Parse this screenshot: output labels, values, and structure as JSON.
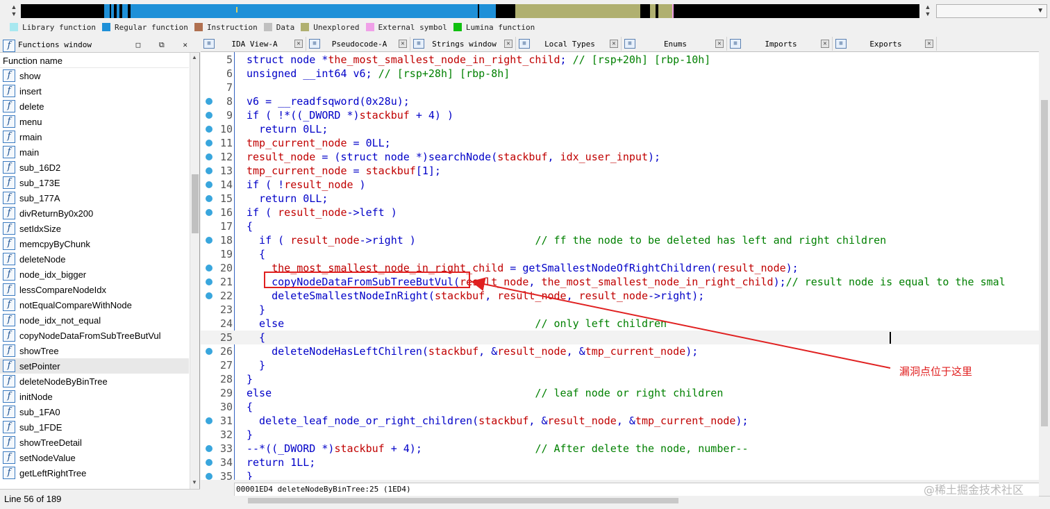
{
  "colors": {
    "library": "#a8e8f0",
    "regular": "#1e90d8",
    "instruction": "#b07050",
    "data": "#c0c0c0",
    "unexplored": "#b0b070",
    "external": "#f0a0e8",
    "lumina": "#10c010",
    "annotation": "#e02020"
  },
  "legend": [
    {
      "label": "Library function",
      "color": "#a8e8f0"
    },
    {
      "label": "Regular function",
      "color": "#1e90d8"
    },
    {
      "label": "Instruction",
      "color": "#b07050"
    },
    {
      "label": "Data",
      "color": "#c0c0c0"
    },
    {
      "label": "Unexplored",
      "color": "#b0b070"
    },
    {
      "label": "External symbol",
      "color": "#f0a0e8"
    },
    {
      "label": "Lumina function",
      "color": "#10c010"
    }
  ],
  "functions_window": {
    "title": "Functions window",
    "header": "Function name",
    "status": "Line 56 of 189",
    "items": [
      "show",
      "insert",
      "delete",
      "menu",
      "rmain",
      "main",
      "sub_16D2",
      "sub_173E",
      "sub_177A",
      "divReturnBy0x200",
      "setIdxSize",
      "memcpyByChunk",
      "deleteNode",
      "node_idx_bigger",
      "lessCompareNodeIdx",
      "notEqualCompareWithNode",
      "node_idx_not_equal",
      "copyNodeDataFromSubTreeButVul",
      "showTree",
      "setPointer",
      "deleteNodeByBinTree",
      "initNode",
      "sub_1FA0",
      "sub_1FDE",
      "showTreeDetail",
      "setNodeValue",
      "getLeftRightTree"
    ],
    "selected": "setPointer"
  },
  "tabs": [
    {
      "label": "IDA View-A",
      "icon": "ida-view-icon"
    },
    {
      "label": "Pseudocode-A",
      "icon": "pseudocode-icon"
    },
    {
      "label": "Strings window",
      "icon": "strings-icon"
    },
    {
      "label": "Local Types",
      "icon": "local-types-icon"
    },
    {
      "label": "Enums",
      "icon": "enums-icon"
    },
    {
      "label": "Imports",
      "icon": "imports-icon"
    },
    {
      "label": "Exports",
      "icon": "exports-icon"
    }
  ],
  "code_lines": [
    {
      "n": "5",
      "bp": false,
      "text": "struct node *the_most_smallest_node_in_right_child; // [rsp+20h] [rbp-10h]"
    },
    {
      "n": "6",
      "bp": false,
      "text": "unsigned __int64 v6; // [rsp+28h] [rbp-8h]"
    },
    {
      "n": "7",
      "bp": false,
      "text": ""
    },
    {
      "n": "8",
      "bp": true,
      "text": "v6 = __readfsqword(0x28u);"
    },
    {
      "n": "9",
      "bp": true,
      "text": "if ( !*((_DWORD *)stackbuf + 4) )"
    },
    {
      "n": "10",
      "bp": true,
      "text": "  return 0LL;"
    },
    {
      "n": "11",
      "bp": true,
      "text": "tmp_current_node = 0LL;"
    },
    {
      "n": "12",
      "bp": true,
      "text": "result_node = (struct node *)searchNode(stackbuf, idx_user_input);"
    },
    {
      "n": "13",
      "bp": true,
      "text": "tmp_current_node = stackbuf[1];"
    },
    {
      "n": "14",
      "bp": true,
      "text": "if ( !result_node )"
    },
    {
      "n": "15",
      "bp": true,
      "text": "  return 0LL;"
    },
    {
      "n": "16",
      "bp": true,
      "text": "if ( result_node->left )"
    },
    {
      "n": "17",
      "bp": false,
      "text": "{"
    },
    {
      "n": "18",
      "bp": true,
      "text": "  if ( result_node->right )                   // ff the node to be deleted has left and right children"
    },
    {
      "n": "19",
      "bp": false,
      "text": "  {"
    },
    {
      "n": "20",
      "bp": true,
      "text": "    the_most_smallest_node_in_right_child = getSmallestNodeOfRightChildren(result_node);"
    },
    {
      "n": "21",
      "bp": true,
      "text": "    copyNodeDataFromSubTreeButVul(result_node, the_most_smallest_node_in_right_child);// result node is equal to the smal"
    },
    {
      "n": "22",
      "bp": true,
      "text": "    deleteSmallestNodeInRight(stackbuf, result_node, result_node->right);"
    },
    {
      "n": "23",
      "bp": false,
      "text": "  }"
    },
    {
      "n": "24",
      "bp": false,
      "text": "  else                                        // only left children"
    },
    {
      "n": "25",
      "bp": false,
      "text": "  {"
    },
    {
      "n": "26",
      "bp": true,
      "text": "    deleteNodeHasLeftChilren(stackbuf, &result_node, &tmp_current_node);"
    },
    {
      "n": "27",
      "bp": false,
      "text": "  }"
    },
    {
      "n": "28",
      "bp": false,
      "text": "}"
    },
    {
      "n": "29",
      "bp": false,
      "text": "else                                          // leaf node or right children"
    },
    {
      "n": "30",
      "bp": false,
      "text": "{"
    },
    {
      "n": "31",
      "bp": true,
      "text": "  delete_leaf_node_or_right_children(stackbuf, &result_node, &tmp_current_node);"
    },
    {
      "n": "32",
      "bp": false,
      "text": "}"
    },
    {
      "n": "33",
      "bp": true,
      "text": "--*((_DWORD *)stackbuf + 4);                  // After delete the node, number--"
    },
    {
      "n": "34",
      "bp": true,
      "text": "return 1LL;"
    },
    {
      "n": "35",
      "bp": true,
      "text": "}"
    }
  ],
  "highlighted_line": "25",
  "status_bar": "00001ED4 deleteNodeByBinTree:25 (1ED4)",
  "annotation": {
    "text": "漏洞点位于这里"
  },
  "watermark": "@稀土掘金技术社区"
}
